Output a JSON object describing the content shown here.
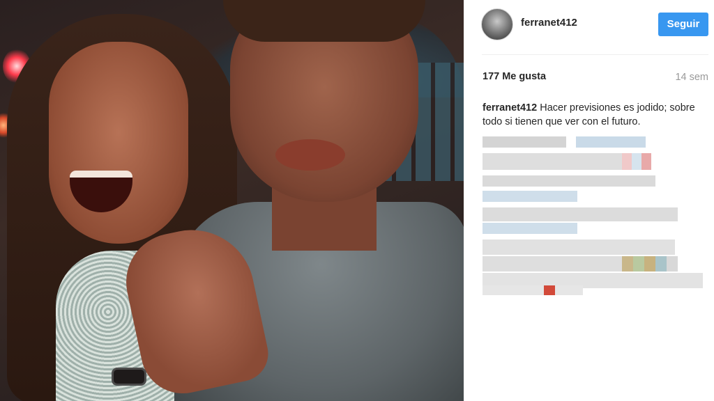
{
  "post": {
    "username": "ferranet412",
    "follow_label": "Seguir",
    "likes": "177 Me gusta",
    "time_ago": "14 sem",
    "caption_user": "ferranet412",
    "caption_text": "Hacer previsiones es jodido; sobre todo si tienen que ver con el futuro."
  },
  "colors": {
    "follow_button": "#3897f0",
    "text_primary": "#262626",
    "text_secondary": "#999999"
  },
  "comments": {
    "note": ""
  }
}
